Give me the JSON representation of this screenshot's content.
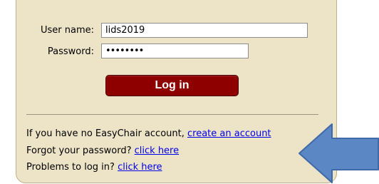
{
  "login": {
    "username_label": "User name:",
    "username_value": "lids2019",
    "password_label": "Password:",
    "password_value": "••••••••",
    "login_button": "Log in"
  },
  "help": {
    "no_account_text": "If you have no EasyChair account, ",
    "create_account_link": "create an account",
    "forgot_text": "Forgot your password? ",
    "forgot_link": "click here",
    "problems_text": "Problems to log in? ",
    "problems_link": "click here"
  },
  "annotation": {
    "arrow_icon": "arrow-left-icon",
    "arrow_color": "#5b87c4"
  },
  "colors": {
    "panel_bg": "#ede3c7",
    "button_bg": "#8e0000",
    "link": "#0000ee"
  }
}
